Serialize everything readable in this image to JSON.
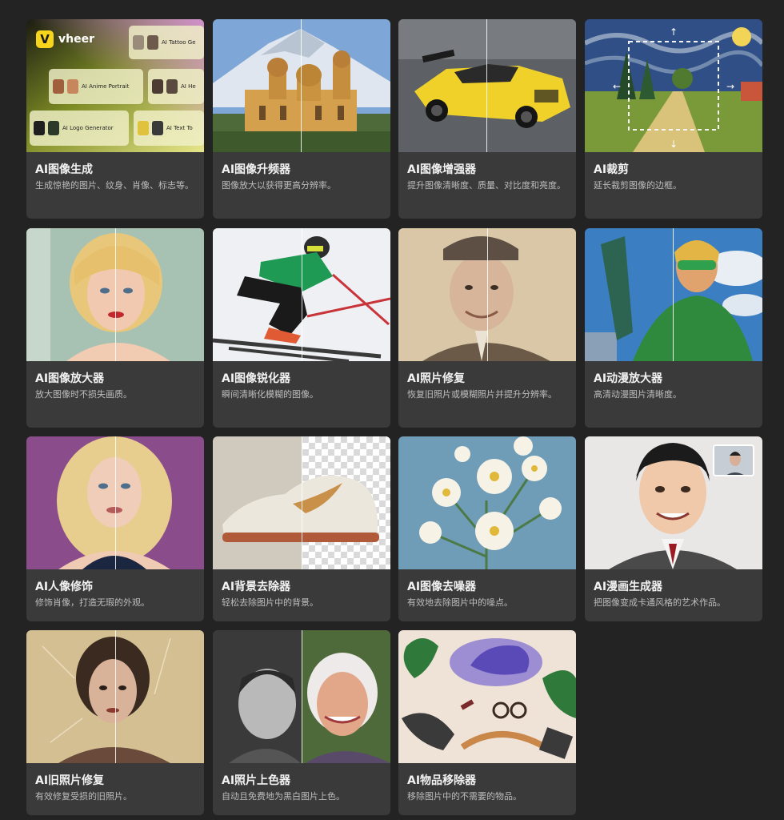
{
  "brand": {
    "name": "vheer",
    "mark": "V"
  },
  "logo_tile_chips": [
    "AI Tattoo Ge",
    "AI Anime Portrait",
    "AI He",
    "AI Logo Generator",
    "AI Text To"
  ],
  "cards": [
    {
      "title": "AI图像生成",
      "desc": "生成惊艳的图片、纹身、肖像、标志等。",
      "icon": "ai-image-generator-thumbnail"
    },
    {
      "title": "AI图像升频器",
      "desc": "图像放大以获得更高分辨率。",
      "icon": "cathedral-thumbnail"
    },
    {
      "title": "AI图像增强器",
      "desc": "提升图像清晰度、质量、对比度和亮度。",
      "icon": "sports-car-thumbnail"
    },
    {
      "title": "AI裁剪",
      "desc": "延长裁剪图像的边框。",
      "icon": "landscape-painting-thumbnail"
    },
    {
      "title": "AI图像放大器",
      "desc": "放大图像时不损失画质。",
      "icon": "blonde-portrait-thumbnail"
    },
    {
      "title": "AI图像锐化器",
      "desc": "瞬间清晰化模糊的图像。",
      "icon": "skier-thumbnail"
    },
    {
      "title": "AI照片修复",
      "desc": "恢复旧照片或模糊照片并提升分辨率。",
      "icon": "old-man-photo-thumbnail"
    },
    {
      "title": "AI动漫放大器",
      "desc": "高清动漫图片清晰度。",
      "icon": "anime-hero-thumbnail"
    },
    {
      "title": "AI人像修饰",
      "desc": "修饰肖像，打造无瑕的外观。",
      "icon": "woman-portrait-thumbnail"
    },
    {
      "title": "AI背景去除器",
      "desc": "轻松去除图片中的背景。",
      "icon": "sneaker-thumbnail"
    },
    {
      "title": "AI图像去噪器",
      "desc": "有效地去除图片中的噪点。",
      "icon": "flowers-thumbnail"
    },
    {
      "title": "AI漫画生成器",
      "desc": "把图像变成卡通风格的艺术作品。",
      "icon": "cartoon-man-thumbnail"
    },
    {
      "title": "AI旧照片修复",
      "desc": "有效修复受损的旧照片。",
      "icon": "vintage-woman-photo-thumbnail"
    },
    {
      "title": "AI照片上色器",
      "desc": "自动且免费地为黑白图片上色。",
      "icon": "colorized-portraits-thumbnail"
    },
    {
      "title": "AI物品移除器",
      "desc": "移除图片中的不需要的物品。",
      "icon": "objects-flatlay-thumbnail"
    }
  ],
  "colors": {
    "background": "#232323",
    "card": "#3a3a3a",
    "title": "#f2f2f2",
    "desc": "#bdbdbd",
    "brand_yellow": "#f7d51d"
  }
}
